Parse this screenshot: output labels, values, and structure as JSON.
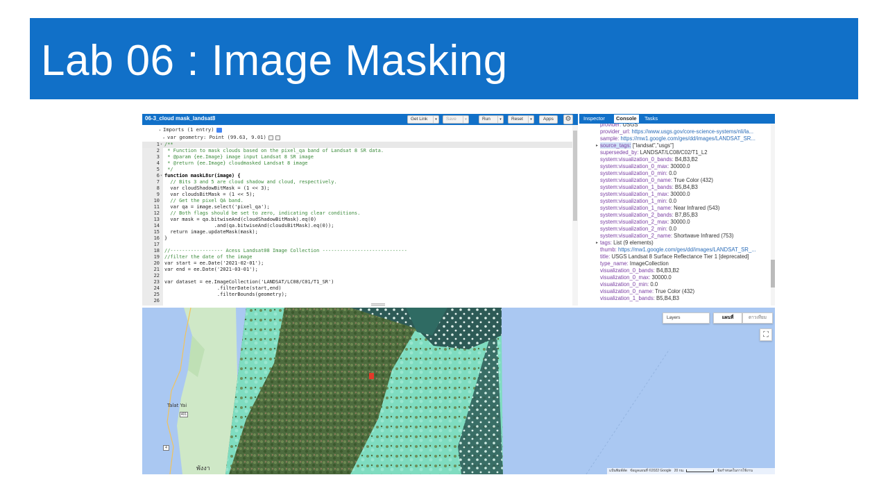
{
  "slide": {
    "title": "Lab 06 : Image Masking"
  },
  "editor": {
    "script_name": "06-3_cloud mask_landsat8",
    "buttons": {
      "get_link": "Get Link",
      "save": "Save",
      "run": "Run",
      "reset": "Reset",
      "apps": "Apps"
    },
    "imports_header": "Imports (1 entry)",
    "imports_var": "var geometry: Point (99.63, 9.01)",
    "code_lines": [
      {
        "n": "1",
        "fold": "▾",
        "text": "/**",
        "cls": "c-comment"
      },
      {
        "n": "2",
        "fold": "",
        "text": " * Function to mask clouds based on the pixel_qa band of Landsat 8 SR data.",
        "cls": "c-comment"
      },
      {
        "n": "3",
        "fold": "",
        "text": " * @param {ee.Image} image input Landsat 8 SR image",
        "cls": "c-comment"
      },
      {
        "n": "4",
        "fold": "",
        "text": " * @return {ee.Image} cloudmasked Landsat 8 image",
        "cls": "c-comment"
      },
      {
        "n": "5",
        "fold": "",
        "text": " */",
        "cls": "c-comment"
      },
      {
        "n": "6",
        "fold": "▾",
        "text": "function maskL8sr(image) {",
        "cls": "c-kw"
      },
      {
        "n": "7",
        "fold": "",
        "text": "  // Bits 3 and 5 are cloud shadow and cloud, respectively.",
        "cls": "c-comment"
      },
      {
        "n": "8",
        "fold": "",
        "text": "  var cloudShadowBitMask = (1 << 3);",
        "cls": ""
      },
      {
        "n": "9",
        "fold": "",
        "text": "  var cloudsBitMask = (1 << 5);",
        "cls": ""
      },
      {
        "n": "10",
        "fold": "",
        "text": "  // Get the pixel QA band.",
        "cls": "c-comment"
      },
      {
        "n": "11",
        "fold": "",
        "text": "  var qa = image.select('pixel_qa');",
        "cls": ""
      },
      {
        "n": "12",
        "fold": "",
        "text": "  // Both flags should be set to zero, indicating clear conditions.",
        "cls": "c-comment"
      },
      {
        "n": "13",
        "fold": "",
        "text": "  var mask = qa.bitwiseAnd(cloudShadowBitMask).eq(0)",
        "cls": ""
      },
      {
        "n": "14",
        "fold": "",
        "text": "                 .and(qa.bitwiseAnd(cloudsBitMask).eq(0));",
        "cls": ""
      },
      {
        "n": "15",
        "fold": "",
        "text": "  return image.updateMask(mask);",
        "cls": ""
      },
      {
        "n": "16",
        "fold": "",
        "text": "}",
        "cls": ""
      },
      {
        "n": "17",
        "fold": "",
        "text": "",
        "cls": ""
      },
      {
        "n": "18",
        "fold": "",
        "text": "//------------------ Acess Landsat08 Image Collection -----------------------------",
        "cls": "c-comment"
      },
      {
        "n": "19",
        "fold": "",
        "text": "//filter the date of the image",
        "cls": "c-comment"
      },
      {
        "n": "20",
        "fold": "",
        "text": "var start = ee.Date('2021-02-01');",
        "cls": ""
      },
      {
        "n": "21",
        "fold": "",
        "text": "var end = ee.Date('2021-03-01');",
        "cls": ""
      },
      {
        "n": "22",
        "fold": "",
        "text": "",
        "cls": ""
      },
      {
        "n": "23",
        "fold": "",
        "text": "var dataset = ee.ImageCollection('LANDSAT/LC08/C01/T1_SR')",
        "cls": ""
      },
      {
        "n": "24",
        "fold": "",
        "text": "                  .filterDate(start,end)",
        "cls": ""
      },
      {
        "n": "25",
        "fold": "",
        "text": "                  .filterBounds(geometry);",
        "cls": ""
      },
      {
        "n": "26",
        "fold": "",
        "text": "",
        "cls": ""
      }
    ]
  },
  "console": {
    "tabs": [
      "Inspector",
      "Console",
      "Tasks"
    ],
    "active_tab": "Console",
    "lines": [
      {
        "k": "provider:",
        "v": " USGS",
        "link": false,
        "arrow": false
      },
      {
        "k": "provider_url:",
        "v": " https://www.usgs.gov/core-science-systems/nli/la...",
        "link": true,
        "arrow": false
      },
      {
        "k": "sample:",
        "v": " https://mw1.google.com/ges/dd/images/LANDSAT_SR...",
        "link": true,
        "arrow": false
      },
      {
        "k": "source_tags:",
        "v": " [\"landsat\",\"usgs\"]",
        "link": false,
        "arrow": true,
        "hl": true
      },
      {
        "k": "superseded_by:",
        "v": " LANDSAT/LC08/C02/T1_L2",
        "link": false,
        "arrow": false
      },
      {
        "k": "system:visualization_0_bands:",
        "v": " B4,B3,B2",
        "link": false,
        "arrow": false
      },
      {
        "k": "system:visualization_0_max:",
        "v": " 30000.0",
        "link": false,
        "arrow": false
      },
      {
        "k": "system:visualization_0_min:",
        "v": " 0.0",
        "link": false,
        "arrow": false
      },
      {
        "k": "system:visualization_0_name:",
        "v": " True Color (432)",
        "link": false,
        "arrow": false
      },
      {
        "k": "system:visualization_1_bands:",
        "v": " B5,B4,B3",
        "link": false,
        "arrow": false
      },
      {
        "k": "system:visualization_1_max:",
        "v": " 30000.0",
        "link": false,
        "arrow": false
      },
      {
        "k": "system:visualization_1_min:",
        "v": " 0.0",
        "link": false,
        "arrow": false
      },
      {
        "k": "system:visualization_1_name:",
        "v": " Near Infrared (543)",
        "link": false,
        "arrow": false
      },
      {
        "k": "system:visualization_2_bands:",
        "v": " B7,B5,B3",
        "link": false,
        "arrow": false
      },
      {
        "k": "system:visualization_2_max:",
        "v": " 30000.0",
        "link": false,
        "arrow": false
      },
      {
        "k": "system:visualization_2_min:",
        "v": " 0.0",
        "link": false,
        "arrow": false
      },
      {
        "k": "system:visualization_2_name:",
        "v": " Shortwave Infrared (753)",
        "link": false,
        "arrow": false
      },
      {
        "k": "tags:",
        "v": " List (9 elements)",
        "link": false,
        "arrow": true
      },
      {
        "k": "thumb:",
        "v": " https://mw1.google.com/ges/dd/images/LANDSAT_SR_...",
        "link": true,
        "arrow": false
      },
      {
        "k": "title:",
        "v": " USGS Landsat 8 Surface Reflectance Tier 1 [deprecated]",
        "link": false,
        "arrow": false
      },
      {
        "k": "type_name:",
        "v": " ImageCollection",
        "link": false,
        "arrow": false
      },
      {
        "k": "visualization_0_bands:",
        "v": " B4,B3,B2",
        "link": false,
        "arrow": false
      },
      {
        "k": "visualization_0_max:",
        "v": " 30000.0",
        "link": false,
        "arrow": false
      },
      {
        "k": "visualization_0_min:",
        "v": " 0.0",
        "link": false,
        "arrow": false
      },
      {
        "k": "visualization_0_name:",
        "v": " True Color (432)",
        "link": false,
        "arrow": false
      },
      {
        "k": "visualization_1_bands:",
        "v": " B5,B4,B3",
        "link": false,
        "arrow": false
      }
    ]
  },
  "map": {
    "layers_label": "Layers",
    "map_type_map": "แผนที่",
    "map_type_satellite": "ดาวเทียม",
    "place_talat_yai": "Talat Yai",
    "shield_401": "401",
    "shield_4": "4",
    "place_phangnga": "พังงา",
    "attribution_shortcuts": "แป้นพิมพ์ลัด",
    "attribution_data": "ข้อมูลแผนที่ ©2022 Google",
    "scale_label": "20 กม.",
    "attribution_terms": "ข้อกำหนดในการใช้งาน"
  },
  "colors": {
    "title_bg": "#1170c8",
    "gee_header": "#1170c8",
    "ocean": "#aac8f2",
    "land": "#cfe8c7",
    "masked_scene": "#7fdcc0"
  }
}
